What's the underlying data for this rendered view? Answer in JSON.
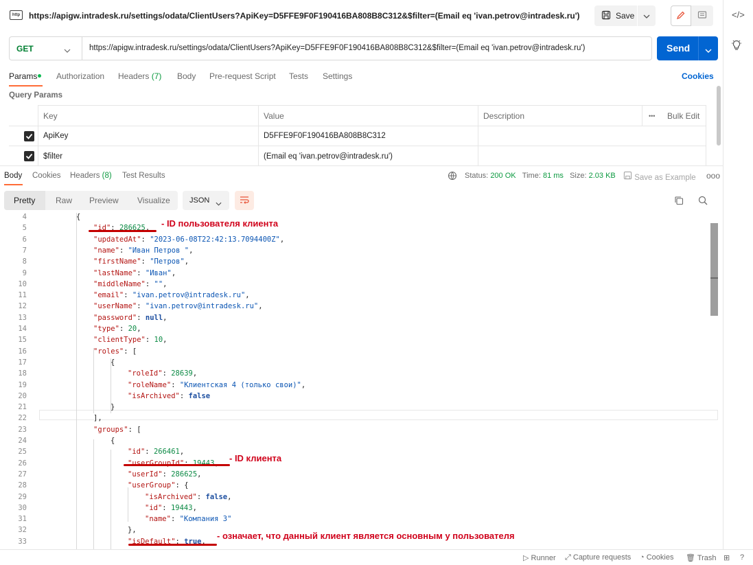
{
  "titlebar": {
    "badge": "http",
    "url": "https://apigw.intradesk.ru/settings/odata/ClientUsers?ApiKey=D5FFE9F0F190416BA808B8C312&$filter=(Email eq 'ivan.petrov@intradesk.ru')",
    "save_label": "Save"
  },
  "request": {
    "method": "GET",
    "url": "https://apigw.intradesk.ru/settings/odata/ClientUsers?ApiKey=D5FFE9F0F190416BA808B8C312&$filter=(Email eq 'ivan.petrov@intradesk.ru')",
    "send_label": "Send"
  },
  "request_tabs": {
    "params": "Params",
    "authorization": "Authorization",
    "headers": "Headers",
    "headers_count": "(7)",
    "body": "Body",
    "prerequest": "Pre-request Script",
    "tests": "Tests",
    "settings": "Settings",
    "cookies": "Cookies"
  },
  "query_params": {
    "title": "Query Params",
    "columns": {
      "key": "Key",
      "value": "Value",
      "description": "Description",
      "bulk_edit": "Bulk Edit",
      "more": "•••"
    },
    "rows": [
      {
        "key": "ApiKey",
        "value": "D5FFE9F0F190416BA808B8C312",
        "description": "",
        "checked": true
      },
      {
        "key": "$filter",
        "value": "(Email eq 'ivan.petrov@intradesk.ru')",
        "description": "",
        "checked": true
      }
    ]
  },
  "response_tabs": {
    "body": "Body",
    "cookies": "Cookies",
    "headers": "Headers",
    "headers_count": "(8)",
    "test_results": "Test Results"
  },
  "response_meta": {
    "status_label": "Status:",
    "status_value": "200 OK",
    "time_label": "Time:",
    "time_value": "81 ms",
    "size_label": "Size:",
    "size_value": "2.03 KB",
    "save_example": "Save as Example",
    "more": "ooo"
  },
  "view": {
    "pretty": "Pretty",
    "raw": "Raw",
    "preview": "Preview",
    "visualize": "Visualize",
    "format": "JSON"
  },
  "code_lines": [
    {
      "n": "4",
      "i": 3,
      "t": [
        [
          "p",
          "{"
        ]
      ]
    },
    {
      "n": "5",
      "i": 4,
      "t": [
        [
          "k",
          "\"id\""
        ],
        [
          "p",
          ": "
        ],
        [
          "n",
          "286625"
        ],
        [
          "p",
          ","
        ]
      ]
    },
    {
      "n": "6",
      "i": 4,
      "t": [
        [
          "k",
          "\"updatedAt\""
        ],
        [
          "p",
          ": "
        ],
        [
          "s",
          "\"2023-06-08T22:42:13.7094400Z\""
        ],
        [
          "p",
          ","
        ]
      ]
    },
    {
      "n": "7",
      "i": 4,
      "t": [
        [
          "k",
          "\"name\""
        ],
        [
          "p",
          ": "
        ],
        [
          "s",
          "\"Иван Петров \""
        ],
        [
          "p",
          ","
        ]
      ]
    },
    {
      "n": "8",
      "i": 4,
      "t": [
        [
          "k",
          "\"firstName\""
        ],
        [
          "p",
          ": "
        ],
        [
          "s",
          "\"Петров\""
        ],
        [
          "p",
          ","
        ]
      ]
    },
    {
      "n": "9",
      "i": 4,
      "t": [
        [
          "k",
          "\"lastName\""
        ],
        [
          "p",
          ": "
        ],
        [
          "s",
          "\"Иван\""
        ],
        [
          "p",
          ","
        ]
      ]
    },
    {
      "n": "10",
      "i": 4,
      "t": [
        [
          "k",
          "\"middleName\""
        ],
        [
          "p",
          ": "
        ],
        [
          "s",
          "\"\""
        ],
        [
          "p",
          ","
        ]
      ]
    },
    {
      "n": "11",
      "i": 4,
      "t": [
        [
          "k",
          "\"email\""
        ],
        [
          "p",
          ": "
        ],
        [
          "s",
          "\"ivan.petrov@intradesk.ru\""
        ],
        [
          "p",
          ","
        ]
      ]
    },
    {
      "n": "12",
      "i": 4,
      "t": [
        [
          "k",
          "\"userName\""
        ],
        [
          "p",
          ": "
        ],
        [
          "s",
          "\"ivan.petrov@intradesk.ru\""
        ],
        [
          "p",
          ","
        ]
      ]
    },
    {
      "n": "13",
      "i": 4,
      "t": [
        [
          "k",
          "\"password\""
        ],
        [
          "p",
          ": "
        ],
        [
          "b",
          "null"
        ],
        [
          "p",
          ","
        ]
      ]
    },
    {
      "n": "14",
      "i": 4,
      "t": [
        [
          "k",
          "\"type\""
        ],
        [
          "p",
          ": "
        ],
        [
          "n",
          "20"
        ],
        [
          "p",
          ","
        ]
      ]
    },
    {
      "n": "15",
      "i": 4,
      "t": [
        [
          "k",
          "\"clientType\""
        ],
        [
          "p",
          ": "
        ],
        [
          "n",
          "10"
        ],
        [
          "p",
          ","
        ]
      ]
    },
    {
      "n": "16",
      "i": 4,
      "t": [
        [
          "k",
          "\"roles\""
        ],
        [
          "p",
          ": ["
        ]
      ]
    },
    {
      "n": "17",
      "i": 5,
      "t": [
        [
          "p",
          "{"
        ]
      ]
    },
    {
      "n": "18",
      "i": 6,
      "t": [
        [
          "k",
          "\"roleId\""
        ],
        [
          "p",
          ": "
        ],
        [
          "n",
          "28639"
        ],
        [
          "p",
          ","
        ]
      ]
    },
    {
      "n": "19",
      "i": 6,
      "t": [
        [
          "k",
          "\"roleName\""
        ],
        [
          "p",
          ": "
        ],
        [
          "s",
          "\"Клиентская 4 (только свои)\""
        ],
        [
          "p",
          ","
        ]
      ]
    },
    {
      "n": "20",
      "i": 6,
      "t": [
        [
          "k",
          "\"isArchived\""
        ],
        [
          "p",
          ": "
        ],
        [
          "b",
          "false"
        ]
      ]
    },
    {
      "n": "21",
      "i": 5,
      "t": [
        [
          "p",
          "}"
        ]
      ]
    },
    {
      "n": "22",
      "i": 4,
      "t": [
        [
          "p",
          "],"
        ]
      ]
    },
    {
      "n": "23",
      "i": 4,
      "t": [
        [
          "k",
          "\"groups\""
        ],
        [
          "p",
          ": ["
        ]
      ]
    },
    {
      "n": "24",
      "i": 5,
      "t": [
        [
          "p",
          "{"
        ]
      ]
    },
    {
      "n": "25",
      "i": 6,
      "t": [
        [
          "k",
          "\"id\""
        ],
        [
          "p",
          ": "
        ],
        [
          "n",
          "266461"
        ],
        [
          "p",
          ","
        ]
      ]
    },
    {
      "n": "26",
      "i": 6,
      "t": [
        [
          "k",
          "\"userGroupId\""
        ],
        [
          "p",
          ": "
        ],
        [
          "n",
          "19443"
        ],
        [
          "p",
          ","
        ]
      ]
    },
    {
      "n": "27",
      "i": 6,
      "t": [
        [
          "k",
          "\"userId\""
        ],
        [
          "p",
          ": "
        ],
        [
          "n",
          "286625"
        ],
        [
          "p",
          ","
        ]
      ]
    },
    {
      "n": "28",
      "i": 6,
      "t": [
        [
          "k",
          "\"userGroup\""
        ],
        [
          "p",
          ": {"
        ]
      ]
    },
    {
      "n": "29",
      "i": 7,
      "t": [
        [
          "k",
          "\"isArchived\""
        ],
        [
          "p",
          ": "
        ],
        [
          "b",
          "false"
        ],
        [
          "p",
          ","
        ]
      ]
    },
    {
      "n": "30",
      "i": 7,
      "t": [
        [
          "k",
          "\"id\""
        ],
        [
          "p",
          ": "
        ],
        [
          "n",
          "19443"
        ],
        [
          "p",
          ","
        ]
      ]
    },
    {
      "n": "31",
      "i": 7,
      "t": [
        [
          "k",
          "\"name\""
        ],
        [
          "p",
          ": "
        ],
        [
          "s",
          "\"Компания 3\""
        ]
      ]
    },
    {
      "n": "32",
      "i": 6,
      "t": [
        [
          "p",
          "},"
        ]
      ]
    },
    {
      "n": "33",
      "i": 6,
      "t": [
        [
          "k",
          "\"isDefault\""
        ],
        [
          "p",
          ": "
        ],
        [
          "b",
          "true"
        ],
        [
          "p",
          ","
        ]
      ]
    }
  ],
  "annotations": {
    "client_user_id": "- ID пользователя клиента",
    "client_id": "- ID клиента",
    "is_default": "- означает, что данный клиент является основным у пользователя"
  },
  "statusbar": {
    "runner": "Runner",
    "capture": "Capture requests",
    "cookies": "Cookies",
    "trash": "Trash"
  },
  "colors": {
    "accent": "#ff6c37",
    "send": "#0265d2",
    "method": "#007f31",
    "annotation": "#d0021b"
  }
}
